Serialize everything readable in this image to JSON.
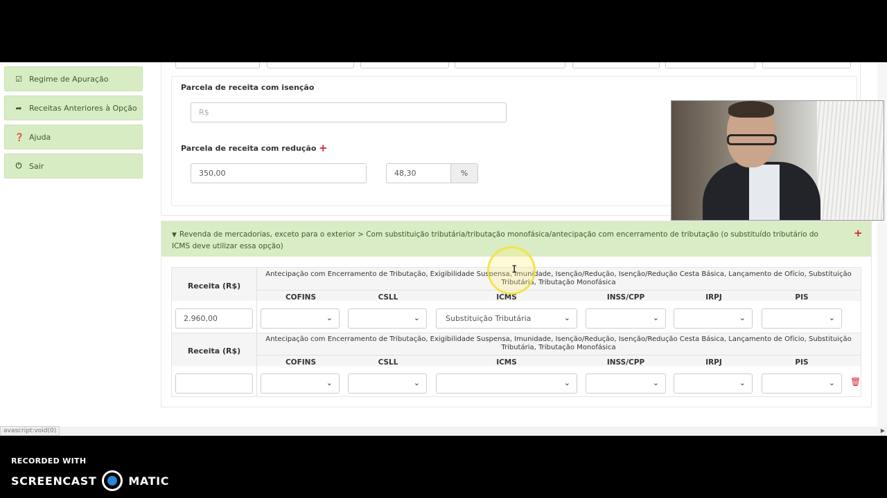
{
  "sidebar": {
    "items": [
      {
        "label": "Regime de Apuração",
        "icon": "check-square-icon"
      },
      {
        "label": "Receitas Anteriores à Opção",
        "icon": "share-arrow-icon"
      },
      {
        "label": "Ajuda",
        "icon": "question-circle-icon"
      },
      {
        "label": "Sair",
        "icon": "power-icon"
      }
    ]
  },
  "upper": {
    "isencao_label": "Parcela de receita com isenção",
    "isencao_placeholder": "R$",
    "reducao_label": "Parcela de receita com redução",
    "reducao_add": "+",
    "reducao_value": "350,00",
    "reducao_percent": "48,30",
    "percent_symbol": "%"
  },
  "section": {
    "caret": "▼",
    "title": "Revenda de mercadorias, exceto para o exterior > Com substituição tributária/tributação monofásica/antecipação com encerramento de tributação (o substituído tributário do ICMS deve utilizar essa opção)",
    "add": "+",
    "rows": [
      {
        "receita_label": "Receita (R$)",
        "description": "Antecipação com Encerramento de Tributação, Exigibilidade Suspensa, Imunidade, Isenção/Redução, Isenção/Redução Cesta Básica, Lançamento de Ofício, Substituição Tributária, Tributação Monofásica",
        "columns": [
          "COFINS",
          "CSLL",
          "ICMS",
          "INSS/CPP",
          "IRPJ",
          "PIS"
        ],
        "receita_value": "2.960,00",
        "selects": [
          "",
          "",
          "Substituição Tributária",
          "",
          "",
          ""
        ]
      },
      {
        "receita_label": "Receita (R$)",
        "description": "Antecipação com Encerramento de Tributação, Exigibilidade Suspensa, Imunidade, Isenção/Redução, Isenção/Redução Cesta Básica, Lançamento de Ofício, Substituição Tributária, Tributação Monofásica",
        "columns": [
          "COFINS",
          "CSLL",
          "ICMS",
          "INSS/CPP",
          "IRPJ",
          "PIS"
        ],
        "receita_value": "",
        "selects": [
          "",
          "",
          "",
          "",
          "",
          ""
        ]
      }
    ],
    "delete_icon": "trash-icon"
  },
  "status_tip": "avascript:void(0)",
  "watermark": {
    "line1": "RECORDED WITH",
    "brand_left": "SCREENCAST",
    "brand_right": "MATIC"
  },
  "colors": {
    "sidebar_bg": "#d8ecc4",
    "section_head_bg": "#d9ecc5",
    "accent_red": "#d9232e"
  }
}
